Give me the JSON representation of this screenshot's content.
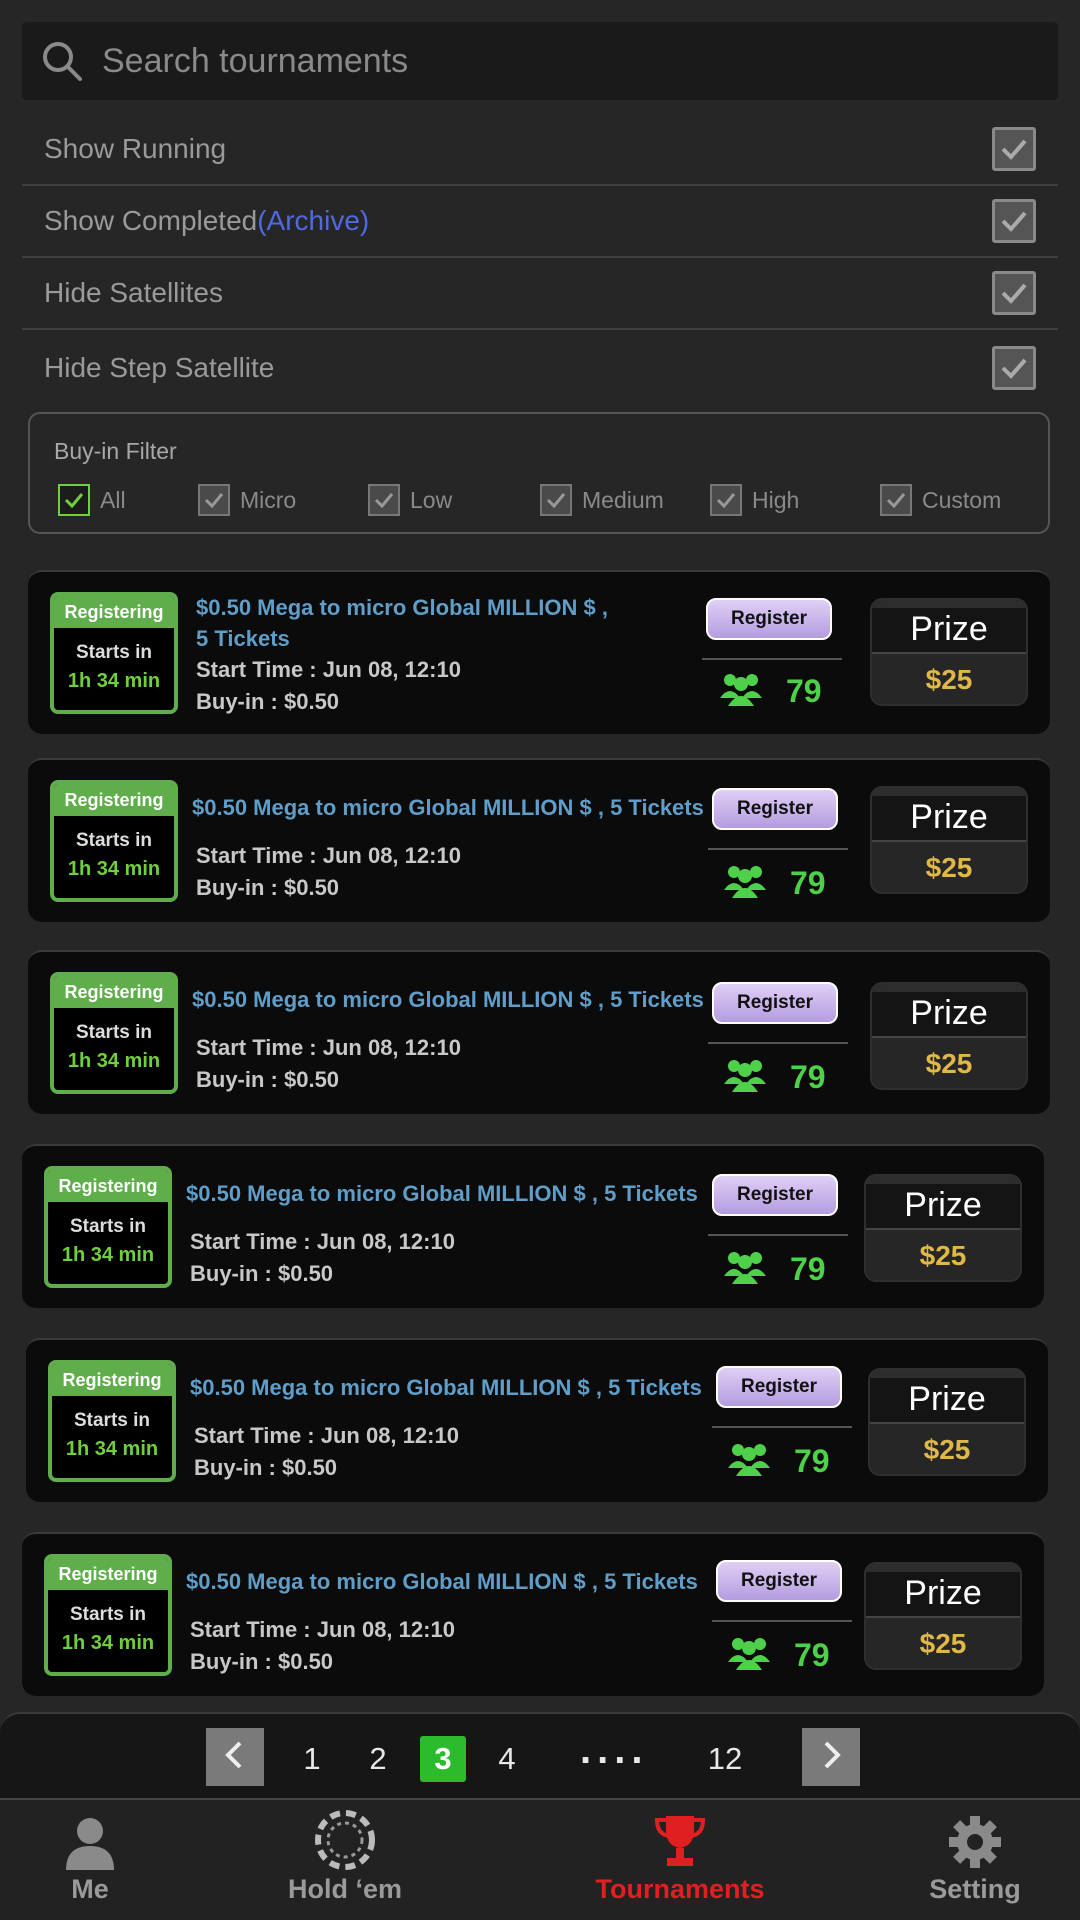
{
  "search": {
    "placeholder": "Search tournaments"
  },
  "filters": [
    {
      "label": "Show Running",
      "checked": true
    },
    {
      "label": "Show Completed",
      "suffix": "(Archive)",
      "checked": true
    },
    {
      "label": "Hide Satellites",
      "checked": true
    },
    {
      "label": "Hide Step Satellite",
      "checked": true
    }
  ],
  "buyin_filter": {
    "title": "Buy-in Filter",
    "options": [
      {
        "label": "All",
        "checked": true
      },
      {
        "label": "Micro",
        "checked": true
      },
      {
        "label": "Low",
        "checked": true
      },
      {
        "label": "Medium",
        "checked": true
      },
      {
        "label": "High",
        "checked": true
      },
      {
        "label": "Custom",
        "checked": true
      }
    ]
  },
  "tournaments": [
    {
      "status": "Registering",
      "starts_label": "Starts in",
      "starts_in": "1h 34 min",
      "name_line1": "$0.50 Mega to micro Global MILLION $ ,",
      "name_line2": "5 Tickets",
      "start_time": "Start Time : Jun 08, 12:10",
      "buyin": "Buy-in : $0.50",
      "register_label": "Register",
      "players": "79",
      "prize_label": "Prize",
      "prize": "$25"
    },
    {
      "status": "Registering",
      "starts_label": "Starts in",
      "starts_in": "1h 34 min",
      "name": "$0.50 Mega to micro Global MILLION $ , 5 Tickets",
      "start_time": "Start Time : Jun 08, 12:10",
      "buyin": "Buy-in : $0.50",
      "register_label": "Register",
      "players": "79",
      "prize_label": "Prize",
      "prize": "$25"
    },
    {
      "status": "Registering",
      "starts_label": "Starts in",
      "starts_in": "1h 34 min",
      "name": "$0.50 Mega to micro Global MILLION $ , 5 Tickets",
      "start_time": "Start Time : Jun 08, 12:10",
      "buyin": "Buy-in : $0.50",
      "register_label": "Register",
      "players": "79",
      "prize_label": "Prize",
      "prize": "$25"
    },
    {
      "status": "Registering",
      "starts_label": "Starts in",
      "starts_in": "1h 34 min",
      "name": "$0.50 Mega to micro Global MILLION $ , 5 Tickets",
      "start_time": "Start Time : Jun 08, 12:10",
      "buyin": "Buy-in : $0.50",
      "register_label": "Register",
      "players": "79",
      "prize_label": "Prize",
      "prize": "$25"
    },
    {
      "status": "Registering",
      "starts_label": "Starts in",
      "starts_in": "1h 34 min",
      "name": "$0.50 Mega to micro Global MILLION $ , 5 Tickets",
      "start_time": "Start Time : Jun 08, 12:10",
      "buyin": "Buy-in : $0.50",
      "register_label": "Register",
      "players": "79",
      "prize_label": "Prize",
      "prize": "$25"
    },
    {
      "status": "Registering",
      "starts_label": "Starts in",
      "starts_in": "1h 34 min",
      "name": "$0.50 Mega to micro Global MILLION $ , 5 Tickets",
      "start_time": "Start Time : Jun 08, 12:10",
      "buyin": "Buy-in : $0.50",
      "register_label": "Register",
      "players": "79",
      "prize_label": "Prize",
      "prize": "$25"
    }
  ],
  "pagination": {
    "pages": [
      "1",
      "2",
      "3",
      "4"
    ],
    "ellipsis": "....",
    "last": "12",
    "current": "3"
  },
  "tabs": [
    {
      "label": "Me",
      "icon": "person-icon"
    },
    {
      "label": "Hold ‘em",
      "icon": "poker-chip-icon"
    },
    {
      "label": "Tournaments",
      "icon": "trophy-icon",
      "active": true
    },
    {
      "label": "Setting",
      "icon": "gear-icon"
    }
  ],
  "colors": {
    "accent_green": "#5fae4b",
    "player_green": "#4fd04a",
    "prize_gold": "#e0b84a",
    "active_tab_red": "#e02020",
    "archive_blue": "#4f6ae0",
    "title_blue": "#5f9ec8"
  }
}
